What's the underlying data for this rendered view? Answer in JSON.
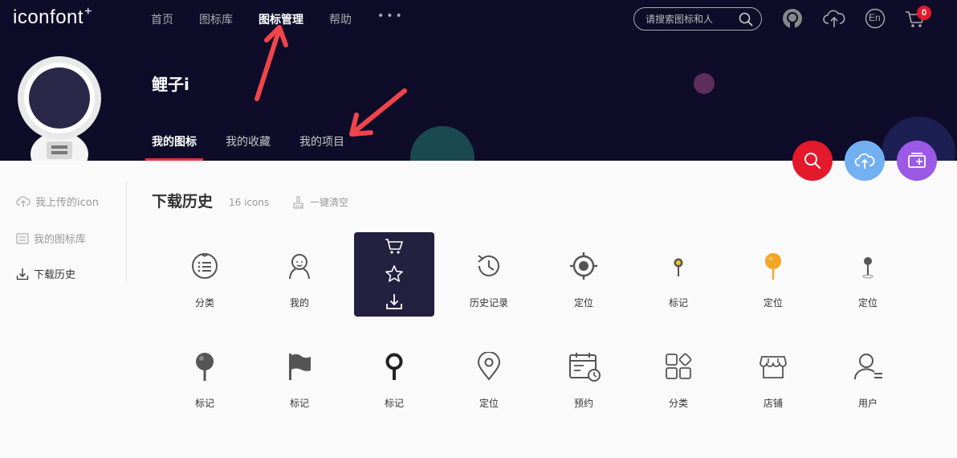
{
  "header": {
    "logo": "iconfont",
    "logo_plus": "+",
    "nav": [
      {
        "label": "首页"
      },
      {
        "label": "图标库"
      },
      {
        "label": "图标管理"
      },
      {
        "label": "帮助"
      }
    ],
    "nav_more": "•••",
    "search_placeholder": "请搜索图标和人",
    "lang_label": "En",
    "cart_count": "0"
  },
  "profile": {
    "username": "鲤子i",
    "tabs": [
      {
        "label": "我的图标"
      },
      {
        "label": "我的收藏"
      },
      {
        "label": "我的项目"
      }
    ]
  },
  "sidebar": {
    "items": [
      {
        "label": "我上传的icon"
      },
      {
        "label": "我的图标库"
      },
      {
        "label": "下载历史"
      }
    ]
  },
  "main": {
    "title": "下载历史",
    "count": "16 icons",
    "clear_label": "一键清空",
    "icons": [
      {
        "label": "分类",
        "icon": "list-circle-icon"
      },
      {
        "label": "我的",
        "icon": "user-face-icon"
      },
      {
        "label": "",
        "icon": "hidden-under-hover-icon"
      },
      {
        "label": "历史记录",
        "icon": "history-clock-icon"
      },
      {
        "label": "定位",
        "icon": "target-icon"
      },
      {
        "label": "标记",
        "icon": "pin-dot-icon"
      },
      {
        "label": "定位",
        "icon": "lollipop-pin-icon"
      },
      {
        "label": "定位",
        "icon": "small-pin-icon"
      },
      {
        "label": "标记",
        "icon": "round-pin-icon"
      },
      {
        "label": "标记",
        "icon": "flag-icon"
      },
      {
        "label": "标记",
        "icon": "ring-pin-icon"
      },
      {
        "label": "定位",
        "icon": "location-marker-icon"
      },
      {
        "label": "预约",
        "icon": "calendar-clock-icon"
      },
      {
        "label": "分类",
        "icon": "category-grid-icon"
      },
      {
        "label": "店铺",
        "icon": "shop-icon"
      },
      {
        "label": "用户",
        "icon": "user-list-icon"
      }
    ]
  },
  "colors": {
    "header_bg": "#0f0c29",
    "accent_red": "#e3192c",
    "fab_blue": "#72b0f1",
    "fab_purple": "#9b59e6",
    "hover_card": "#23213f",
    "orange": "#f5a623"
  }
}
